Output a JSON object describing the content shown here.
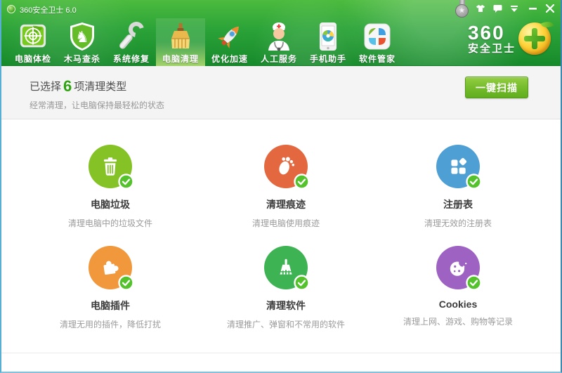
{
  "window": {
    "title": "360安全卫士 6.0",
    "controls": {
      "medal": "badge-medal",
      "skin": "change-skin",
      "feedback": "feedback",
      "menu": "main-menu",
      "minimize": "minimize",
      "close": "close"
    }
  },
  "logo": {
    "line1": "360",
    "line2": "安全卫士"
  },
  "nav": {
    "tabs": [
      {
        "label": "电脑体检",
        "icon": "radar-icon",
        "active": false
      },
      {
        "label": "木马查杀",
        "icon": "shield-horse-icon",
        "active": false
      },
      {
        "label": "系统修复",
        "icon": "wrench-icon",
        "active": false
      },
      {
        "label": "电脑清理",
        "icon": "broom-tab-icon",
        "active": true
      },
      {
        "label": "优化加速",
        "icon": "rocket-icon",
        "active": false
      },
      {
        "label": "人工服务",
        "icon": "doctor-icon",
        "active": false
      },
      {
        "label": "手机助手",
        "icon": "phone-icon",
        "active": false
      },
      {
        "label": "软件管家",
        "icon": "software-grid-icon",
        "active": false
      }
    ]
  },
  "header": {
    "selected_prefix": "已选择",
    "selected_count": "6",
    "selected_suffix": "项清理类型",
    "subtitle": "经常清理，让电脑保持最轻松的状态",
    "scan_button": "一键扫描"
  },
  "colors": {
    "chrome_green": "#2ba338",
    "active_tab_green": "#a4d36b",
    "count_green": "#2fa30f",
    "button_green": "#76bc2c",
    "badge_green": "#53c22b"
  },
  "items": [
    {
      "title": "电脑垃圾",
      "desc": "清理电脑中的垃圾文件",
      "color": "#84c225",
      "icon": "trash-icon"
    },
    {
      "title": "清理痕迹",
      "desc": "清理电脑使用痕迹",
      "color": "#e4683f",
      "icon": "footprint-icon"
    },
    {
      "title": "注册表",
      "desc": "清理无效的注册表",
      "color": "#4e9fd4",
      "icon": "registry-blocks-icon"
    },
    {
      "title": "电脑插件",
      "desc": "清理无用的插件，降低打扰",
      "color": "#f0983b",
      "icon": "puzzle-icon"
    },
    {
      "title": "清理软件",
      "desc": "清理推广、弹窗和不常用的软件",
      "color": "#3eb354",
      "icon": "broom-item-icon"
    },
    {
      "title": "Cookies",
      "desc": "清理上网、游戏、购物等记录",
      "color": "#9e62c3",
      "icon": "cookie-icon"
    }
  ]
}
